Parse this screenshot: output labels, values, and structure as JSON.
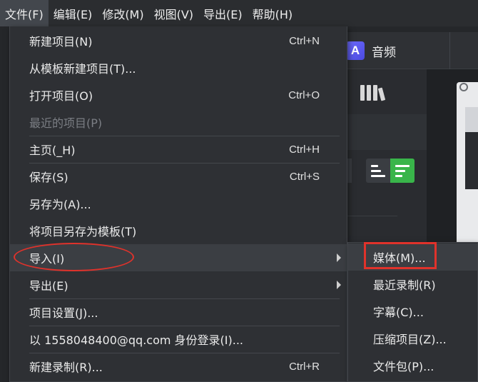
{
  "menubar": {
    "items": [
      {
        "label": "文件(F)",
        "active": true
      },
      {
        "label": "编辑(E)",
        "active": false
      },
      {
        "label": "修改(M)",
        "active": false
      },
      {
        "label": "视图(V)",
        "active": false
      },
      {
        "label": "导出(E)",
        "active": false
      },
      {
        "label": "帮助(H)",
        "active": false
      }
    ]
  },
  "background": {
    "audio_tab_label": "音频",
    "audio_icon_letter": "A"
  },
  "file_menu": {
    "items": [
      {
        "label": "新建项目(N)",
        "shortcut": "Ctrl+N",
        "disabled": false
      },
      {
        "label": "从模板新建项目(T)...",
        "shortcut": "",
        "disabled": false
      },
      {
        "label": "打开项目(O)",
        "shortcut": "Ctrl+O",
        "disabled": false
      },
      {
        "label": "最近的项目(P)",
        "shortcut": "",
        "disabled": true
      },
      {
        "label": "主页(_H)",
        "shortcut": "Ctrl+H",
        "disabled": false
      },
      {
        "label": "保存(S)",
        "shortcut": "Ctrl+S",
        "disabled": false
      },
      {
        "label": "另存为(A)...",
        "shortcut": "",
        "disabled": false
      },
      {
        "label": "将项目另存为模板(T)",
        "shortcut": "",
        "disabled": false
      },
      {
        "label": "导入(I)",
        "shortcut": "",
        "disabled": false,
        "submenu": true,
        "highlighted": true
      },
      {
        "label": "导出(E)",
        "shortcut": "",
        "disabled": false,
        "submenu": true
      },
      {
        "label": "项目设置(J)...",
        "shortcut": "",
        "disabled": false
      },
      {
        "label": "以 1558048400@qq.com 身份登录(I)...",
        "shortcut": "",
        "disabled": false
      },
      {
        "label": "新建录制(R)...",
        "shortcut": "Ctrl+R",
        "disabled": false
      }
    ]
  },
  "import_submenu": {
    "items": [
      {
        "label": "媒体(M)...",
        "highlighted": true
      },
      {
        "label": "最近录制(R)"
      },
      {
        "label": "字幕(C)..."
      },
      {
        "label": "压缩项目(Z)..."
      },
      {
        "label": "文件包(P)..."
      }
    ]
  },
  "colors": {
    "menu_bg": "#2e3034",
    "menubar_bg": "#2b2d30",
    "annotation_red": "#e0322b",
    "sort_green": "#39b54a",
    "audio_purple": "#5b59f0"
  }
}
